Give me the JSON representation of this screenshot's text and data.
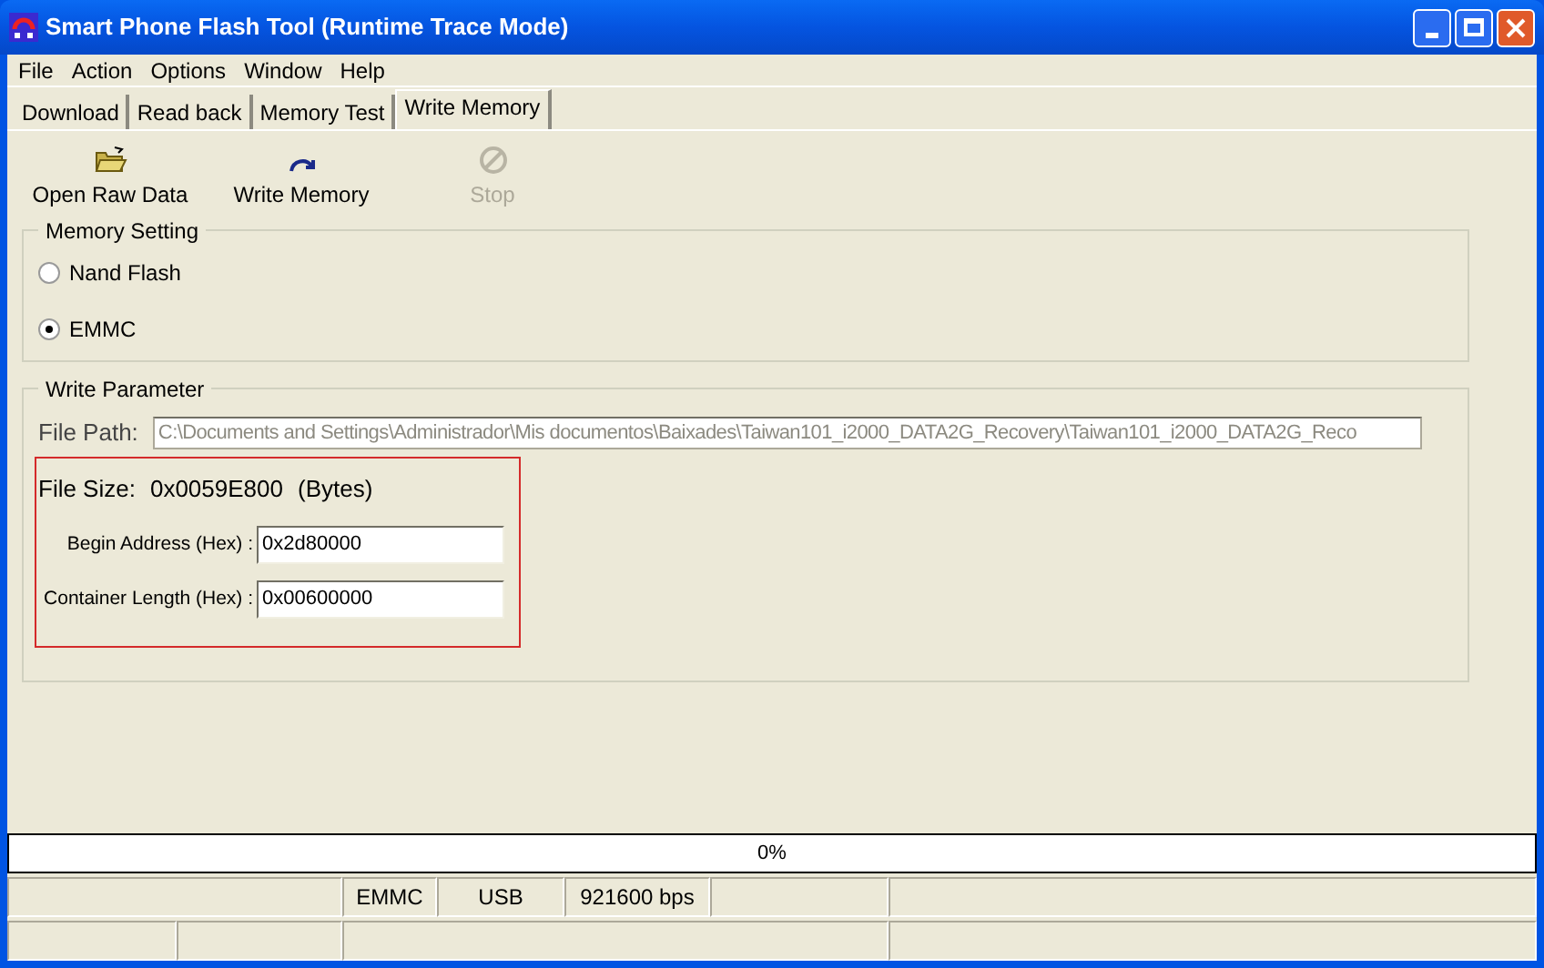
{
  "window": {
    "title": "Smart Phone Flash Tool (Runtime Trace Mode)"
  },
  "menu": [
    "File",
    "Action",
    "Options",
    "Window",
    "Help"
  ],
  "tabs": [
    {
      "label": "Download",
      "selected": false
    },
    {
      "label": "Read back",
      "selected": false
    },
    {
      "label": "Memory Test",
      "selected": false
    },
    {
      "label": "Write Memory",
      "selected": true
    }
  ],
  "toolbar": [
    {
      "label": "Open Raw Data",
      "kind": "open",
      "disabled": false
    },
    {
      "label": "Write Memory",
      "kind": "write",
      "disabled": false
    },
    {
      "label": "Stop",
      "kind": "stop",
      "disabled": true
    }
  ],
  "memory_setting": {
    "title": "Memory Setting",
    "options": [
      {
        "label": "Nand Flash",
        "selected": false
      },
      {
        "label": "EMMC",
        "selected": true
      }
    ]
  },
  "write_parameter": {
    "title": "Write Parameter",
    "file_path_label": "File Path:",
    "file_path": "C:\\Documents and Settings\\Administrador\\Mis documentos\\Baixades\\Taiwan101_i2000_DATA2G_Recovery\\Taiwan101_i2000_DATA2G_Reco",
    "file_size_label": "File Size:",
    "file_size": "0x0059E800",
    "file_size_unit": "(Bytes)",
    "fields": [
      {
        "label": "Begin Address (Hex) :",
        "value": "0x2d80000"
      },
      {
        "label": "Container Length (Hex) :",
        "value": "0x00600000"
      }
    ]
  },
  "progress": {
    "text": "0%",
    "level": 0
  },
  "status_bar": [
    "EMMC",
    "USB",
    "921600 bps"
  ]
}
